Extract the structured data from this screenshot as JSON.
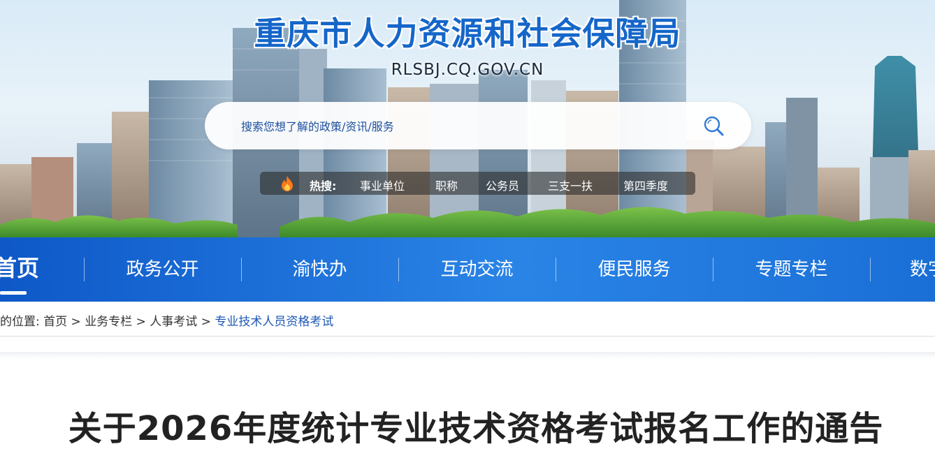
{
  "header": {
    "site_title": "重庆市人力资源和社会保障局",
    "site_domain": "RLSBJ.CQ.GOV.CN"
  },
  "search": {
    "placeholder": "搜索您想了解的政策/资讯/服务",
    "icon": "search-icon"
  },
  "hot_search": {
    "label": "热搜:",
    "icon": "flame-icon",
    "items": [
      "事业单位",
      "职称",
      "公务员",
      "三支一扶",
      "第四季度"
    ]
  },
  "nav": {
    "home": "首页",
    "items": [
      "政务公开",
      "渝快办",
      "互动交流",
      "便民服务",
      "专题专栏",
      "数字"
    ]
  },
  "breadcrumb": {
    "prefix": "的位置:",
    "items": [
      "首页",
      "业务专栏",
      "人事考试"
    ],
    "current": "专业技术人员资格考试",
    "separator": ">"
  },
  "article": {
    "title": "关于2026年度统计专业技术资格考试报名工作的通告"
  },
  "colors": {
    "brand_blue": "#1566c9",
    "nav_blue": "#1a6fd6",
    "breadcrumb_current": "#1e58b5"
  }
}
